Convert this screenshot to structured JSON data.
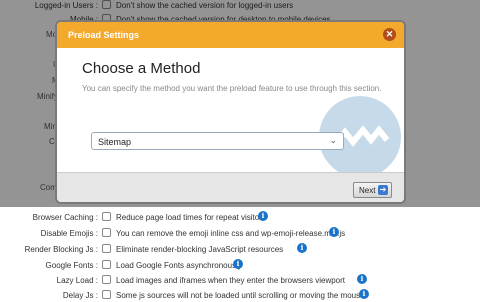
{
  "settings": [
    {
      "label": "Logged-in Users :",
      "desc": "Don't show the cached version for logged-in users"
    },
    {
      "label": "Mobile :",
      "desc": "Don't show the cached version for desktop to mobile devices"
    }
  ],
  "lower_settings": [
    {
      "label": "Browser Caching :",
      "desc": "Reduce page load times for repeat visitors",
      "info": true
    },
    {
      "label": "Disable Emojis :",
      "desc": "You can remove the emoji inline css and wp-emoji-release.min.js",
      "info": true
    },
    {
      "label": "Render Blocking Js :",
      "desc": "Eliminate render-blocking JavaScript resources",
      "info": true
    },
    {
      "label": "Google Fonts :",
      "desc": "Load Google Fonts asynchronously",
      "info": true
    },
    {
      "label": "Lazy Load :",
      "desc": "Load images and iframes when they enter the browsers viewport",
      "info": true
    },
    {
      "label": "Delay Js :",
      "desc": "Some js sources will not be loaded until scrolling or moving the mouse",
      "info": true
    }
  ],
  "partial_labels": [
    "Mo",
    "U",
    "M",
    "Minify",
    "Mini",
    "Co",
    "Comb"
  ],
  "modal": {
    "title": "Preload Settings",
    "close_glyph": "✕",
    "heading": "Choose a Method",
    "text": "You can specify the method you want the preload feature to use through this section.",
    "select_value": "Sitemap",
    "next_label": "Next"
  },
  "icons": {
    "info": "info-icon",
    "close": "close-icon",
    "chevron": "chevron-down-icon",
    "next": "arrow-right-icon"
  },
  "colors": {
    "header": "#f2a92c",
    "close": "#b14d1a",
    "info": "#1a73c8",
    "next_arrow": "#3b7ad0"
  }
}
